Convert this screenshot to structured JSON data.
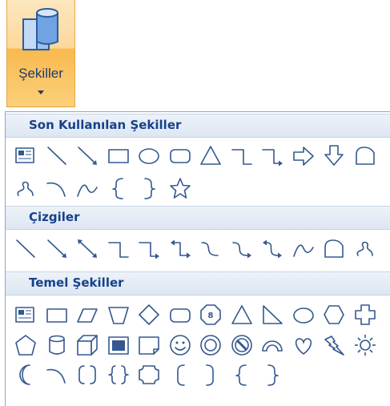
{
  "ribbon_button": {
    "label": "Şekiller",
    "icon": "shapes-icon",
    "state": "pressed"
  },
  "gallery": {
    "sections": [
      {
        "title": "Son Kullanılan Şekiller",
        "rows": [
          [
            "text-box",
            "line",
            "arrow-line",
            "rectangle",
            "oval",
            "rounded-rectangle",
            "triangle",
            "elbow-connector",
            "elbow-arrow-connector",
            "right-arrow",
            "down-arrow",
            "folded-shape"
          ],
          [
            "freeform-scribble",
            "arc",
            "curve",
            "left-brace",
            "right-brace",
            "star"
          ]
        ]
      },
      {
        "title": "Çizgiler",
        "rows": [
          [
            "line",
            "arrow-line",
            "double-arrow-line",
            "elbow-connector",
            "elbow-arrow-connector",
            "elbow-double-arrow-connector",
            "curved-connector",
            "curved-arrow-connector",
            "curved-double-arrow-connector",
            "curve",
            "freeform",
            "scribble"
          ]
        ]
      },
      {
        "title": "Temel Şekiller",
        "rows": [
          [
            "text-box",
            "rectangle",
            "parallelogram",
            "trapezoid",
            "diamond",
            "rounded-rectangle",
            "octagon",
            "triangle",
            "right-triangle",
            "oval",
            "hexagon",
            "cross"
          ],
          [
            "pentagon",
            "can",
            "cube",
            "bevel",
            "folded-corner",
            "smiley-face",
            "donut",
            "no-symbol",
            "block-arc",
            "heart",
            "lightning-bolt",
            "sun"
          ],
          [
            "moon",
            "arc",
            "double-bracket",
            "double-brace",
            "plaque",
            "left-bracket",
            "right-bracket",
            "left-brace",
            "right-brace"
          ]
        ]
      }
    ]
  },
  "colors": {
    "shape_outline": "#34588f",
    "shape_fill": "#ffffff",
    "header_text": "#15428b"
  }
}
